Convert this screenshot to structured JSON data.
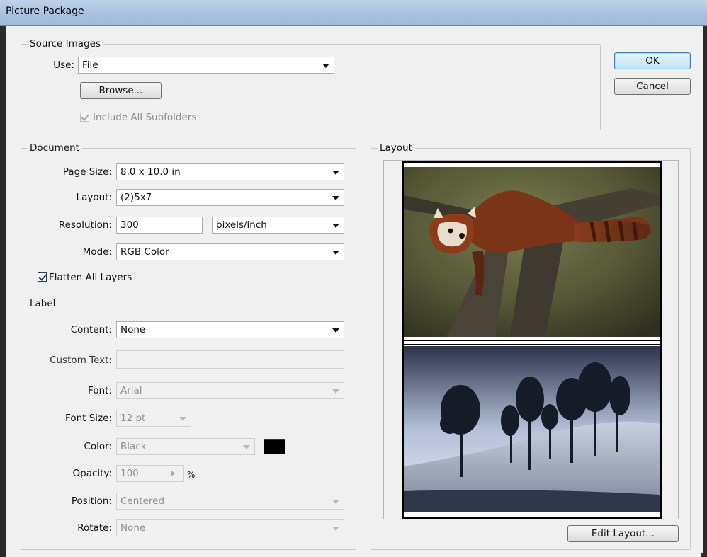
{
  "window": {
    "title": "Picture Package"
  },
  "buttons": {
    "ok": "OK",
    "cancel": "Cancel",
    "browse": "Browse...",
    "edit_layout": "Edit Layout..."
  },
  "source_images": {
    "legend": "Source Images",
    "use_label": "Use:",
    "use_value": "File",
    "include_subfolders_label": "Include All Subfolders",
    "include_subfolders_checked": true
  },
  "document": {
    "legend": "Document",
    "page_size_label": "Page Size:",
    "page_size_value": "8.0 x 10.0 in",
    "layout_label": "Layout:",
    "layout_value": "(2)5x7",
    "resolution_label": "Resolution:",
    "resolution_value": "300",
    "resolution_unit": "pixels/inch",
    "mode_label": "Mode:",
    "mode_value": "RGB Color",
    "flatten_label": "Flatten All Layers",
    "flatten_checked": true
  },
  "label": {
    "legend": "Label",
    "content_label": "Content:",
    "content_value": "None",
    "custom_text_label": "Custom Text:",
    "custom_text_value": "",
    "font_label": "Font:",
    "font_value": "Arial",
    "font_size_label": "Font Size:",
    "font_size_value": "12 pt",
    "color_label": "Color:",
    "color_value": "Black",
    "swatch_color": "#000000",
    "opacity_label": "Opacity:",
    "opacity_value": "100",
    "opacity_unit": "%",
    "position_label": "Position:",
    "position_value": "Centered",
    "rotate_label": "Rotate:",
    "rotate_value": "None"
  },
  "layout_preview": {
    "legend": "Layout",
    "images": [
      "red-panda-photo",
      "trees-on-hill-photo"
    ]
  }
}
